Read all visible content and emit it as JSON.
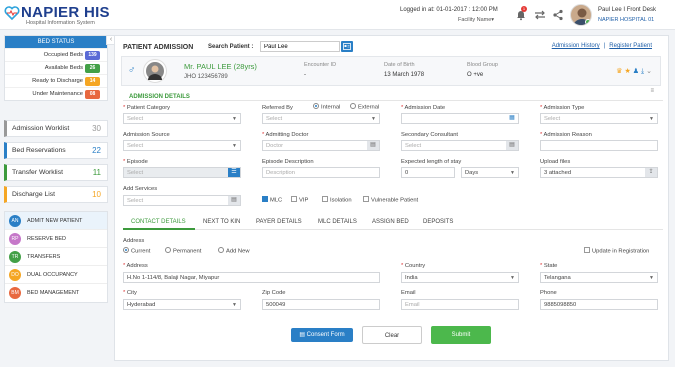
{
  "header": {
    "logo_text": "NAPIER HIS",
    "logo_sub": "Hospital Information System",
    "login_text": "Logged in at: 01-01-2017 : 12:00 PM",
    "facility": "Facility Name▾",
    "notif_count": "1",
    "user": "Paul Lee I Front Desk",
    "hospital": "NAPIER HOSPITAL 01"
  },
  "bed_status": {
    "title": "BED STATUS",
    "rows": [
      {
        "label": "Occupied Beds",
        "count": "139",
        "color": "#5b6bd6"
      },
      {
        "label": "Available Beds",
        "count": "26",
        "color": "#43a047"
      },
      {
        "label": "Ready to Discharge",
        "count": "14",
        "color": "#f5a623"
      },
      {
        "label": "Under Maintenance",
        "count": "08",
        "color": "#e8683f"
      }
    ]
  },
  "worklists": [
    {
      "label": "Admission Worklist",
      "count": "30",
      "color": "#999999"
    },
    {
      "label": "Bed Reservations",
      "count": "22",
      "color": "#2a7fc6"
    },
    {
      "label": "Transfer Worklist",
      "count": "11",
      "color": "#3c9a3c"
    },
    {
      "label": "Discharge List",
      "count": "10",
      "color": "#f5a623"
    }
  ],
  "actions": [
    {
      "abbr": "AN",
      "label": "ADMIT NEW PATIENT",
      "color": "#2a7fc6"
    },
    {
      "abbr": "RP",
      "label": "RESERVE BED",
      "color": "#c678c9"
    },
    {
      "abbr": "TR",
      "label": "TRANSFERS",
      "color": "#43a047"
    },
    {
      "abbr": "DO",
      "label": "DUAL OCCUPANCY",
      "color": "#f5a623"
    },
    {
      "abbr": "BM",
      "label": "BED MANAGEMENT",
      "color": "#e8683f"
    }
  ],
  "main": {
    "title": "PATIENT ADMISSION",
    "search_label": "Search Patient :",
    "search_value": "Paul Lee",
    "link_history": "Admission History",
    "link_register": "Register Patient"
  },
  "patient": {
    "name": "Mr. PAUL LEE (28yrs)",
    "id": "JHO 123456789",
    "encounter_label": "Encounter ID",
    "encounter_value": "-",
    "dob_label": "Date of Birth",
    "dob_value": "13 March 1978",
    "blood_label": "Blood Group",
    "blood_value": "O +ve"
  },
  "admission": {
    "section_title": "ADMISSION DETAILS",
    "patient_category": "Patient Category",
    "referred_by": "Referred By",
    "internal": "Internal",
    "external": "External",
    "admission_date": "Admission Date",
    "admission_type": "Admission Type",
    "admission_source": "Admission Source",
    "admitting_doctor": "Admitting Doctor",
    "secondary_consultant": "Secondary Consultant",
    "admission_reason": "Admission Reason",
    "episode": "Episode",
    "episode_description": "Episode Description",
    "expected_stay": "Expected length of stay",
    "upload_files": "Upload files",
    "add_services": "Add Services",
    "select_ph": "Select",
    "doctor_ph": "Doctor",
    "consultant_ph": "Select",
    "description_ph": "Description",
    "stay_value": "0",
    "stay_unit": "Days",
    "attached": "3 attached",
    "mlc": "MLC",
    "vip": "VIP",
    "isolation": "Isolation",
    "vulnerable": "Vulnerable Patient"
  },
  "tabs": [
    "CONTACT DETAILS",
    "NEXT TO KIN",
    "PAYER DETAILS",
    "MLC DETAILS",
    "ASSIGN BED",
    "DEPOSITS"
  ],
  "contact": {
    "address_label": "Address",
    "current": "Current",
    "permanent": "Permanent",
    "add_new": "Add New",
    "update_reg": "Update in Registration",
    "address_field": "Address",
    "address_value": "H.No 1-114/8, Balaji Nagar, Miyapur",
    "country_label": "Country",
    "country_value": "India",
    "state_label": "State",
    "state_value": "Telangana",
    "city_label": "City",
    "city_value": "Hyderabad",
    "zip_label": "Zip Code",
    "zip_value": "500049",
    "email_label": "Email",
    "email_ph": "Email",
    "phone_label": "Phone",
    "phone_value": "9885098850"
  },
  "buttons": {
    "consent": "Consent Form",
    "clear": "Clear",
    "submit": "Submit"
  }
}
